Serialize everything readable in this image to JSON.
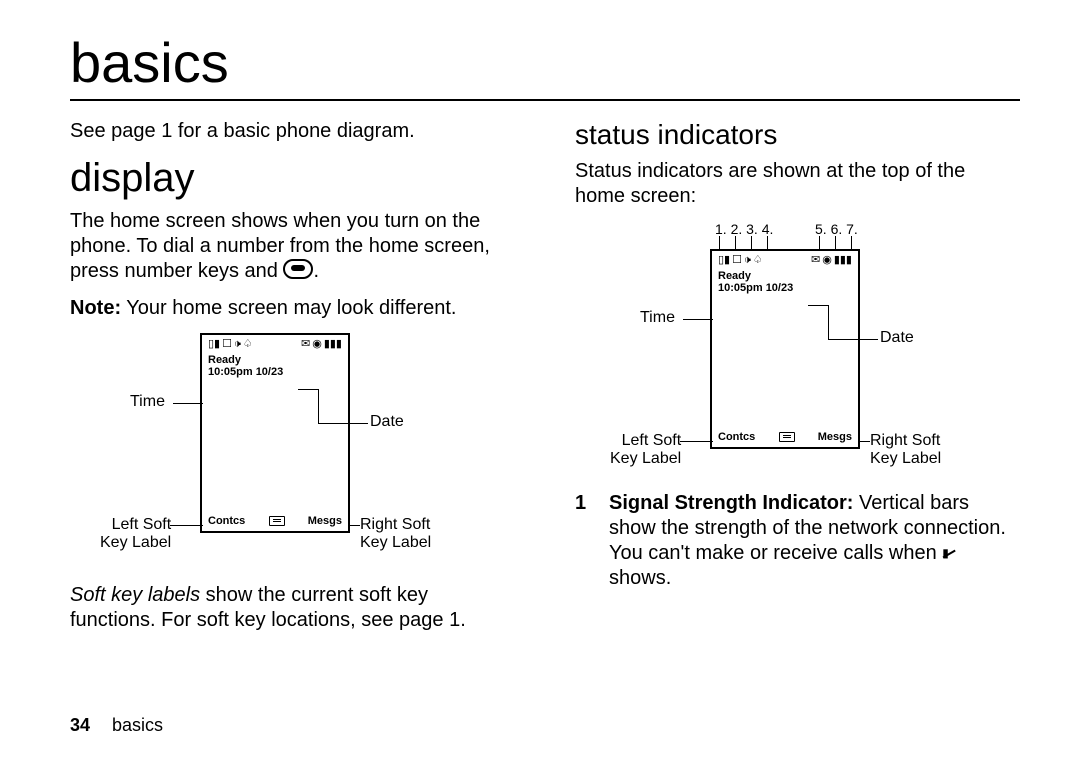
{
  "page_title": "basics",
  "footer": {
    "page_number": "34",
    "section": "basics"
  },
  "left": {
    "see_page": "See page 1 for a basic phone diagram.",
    "display_heading": "display",
    "display_para": "The home screen shows when you turn on the phone. To dial a number from the home screen, press number keys and ",
    "display_para_tail": ".",
    "note_label": "Note:",
    "note_text": " Your home screen may look different.",
    "softkey_para_lead": "Soft key labels",
    "softkey_para_rest": " show the current soft key functions. For soft key locations, see page 1."
  },
  "right": {
    "status_heading": "status indicators",
    "status_para": "Status indicators are shown at the top of the home screen:",
    "item_num": "1",
    "item_label": "Signal Strength Indicator:",
    "item_text": " Vertical bars show the strength of the network connection. You can't make or receive calls when ",
    "item_tail": " shows."
  },
  "phone": {
    "ready": "Ready",
    "time_date": "10:05pm 10/23",
    "soft_left": "Contcs",
    "soft_right": "Mesgs"
  },
  "callouts": {
    "time": "Time",
    "date": "Date",
    "left_soft1": "Left Soft",
    "left_soft2": "Key Label",
    "right_soft1": "Right Soft",
    "right_soft2": "Key Label"
  },
  "numbers": {
    "left_group": "1. 2. 3. 4.",
    "right_group": "5. 6. 7."
  }
}
